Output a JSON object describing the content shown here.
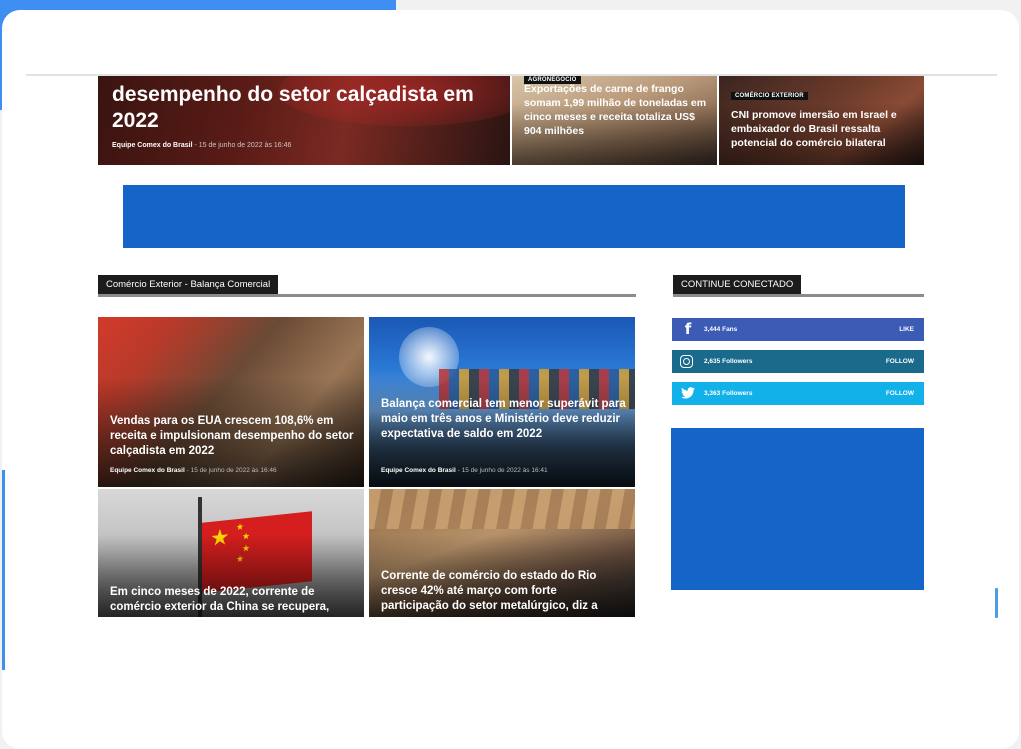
{
  "featured": {
    "main": {
      "title": "desempenho do setor calçadista em 2022",
      "author": "Equipe Comex do Brasil",
      "date": "15 de junho de 2022 às 16:46"
    },
    "second": {
      "category": "AGRONEGÓCIO",
      "title": "Exportações de carne de frango somam 1,99 milhão de toneladas em cinco meses e receita totaliza US$ 904 milhões"
    },
    "third": {
      "category": "COMÉRCIO EXTERIOR",
      "title": "CNI promove imersão em Israel e embaixador do Brasil ressalta potencial do comércio bilateral"
    }
  },
  "section": {
    "title": "Comércio Exterior - Balança Comercial"
  },
  "articles": [
    {
      "title": "Vendas para os EUA crescem 108,6% em receita e impulsionam desempenho do setor calçadista em 2022",
      "author": "Equipe Comex do Brasil",
      "date": "15 de junho de 2022 às 16:46"
    },
    {
      "title": "Balança comercial tem menor superávit para maio em três anos e Ministério deve reduzir expectativa de saldo em 2022",
      "author": "Equipe Comex do Brasil",
      "date": "15 de junho de 2022 às 16:41"
    },
    {
      "title": "Em cinco meses de 2022, corrente de comércio exterior da China se recupera,"
    },
    {
      "title": "Corrente de comércio do estado do Rio cresce 42% até março com forte participação do setor metalúrgico, diz a"
    }
  ],
  "sidebar": {
    "title": "CONTINUE CONECTADO",
    "social": [
      {
        "network": "facebook",
        "icon": "facebook-icon",
        "count": "3,444",
        "unit": "Fans",
        "action": "LIKE",
        "color": "#3b5bb5"
      },
      {
        "network": "instagram",
        "icon": "instagram-icon",
        "count": "2,635",
        "unit": "Followers",
        "action": "FOLLOW",
        "color": "#1a6a8c"
      },
      {
        "network": "twitter",
        "icon": "twitter-icon",
        "count": "3,363",
        "unit": "Followers",
        "action": "FOLLOW",
        "color": "#12b1ea"
      }
    ]
  },
  "colors": {
    "accent": "#3f8ef2",
    "ad_blue": "#1565c8"
  }
}
